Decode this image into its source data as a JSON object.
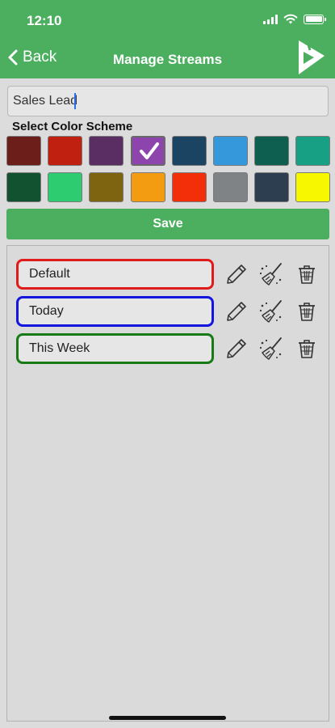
{
  "status_bar": {
    "time": "12:10"
  },
  "nav": {
    "back_label": "Back",
    "title": "Manage Streams"
  },
  "stream_form": {
    "name_value": "Sales Lead",
    "color_label": "Select Color Scheme",
    "swatches": [
      "#6b1e1a",
      "#c0200f",
      "#5a2d63",
      "#8e44ad",
      "#1a4462",
      "#3498db",
      "#0e5f4f",
      "#18a085",
      "#135230",
      "#2ecc71",
      "#7e6410",
      "#f39c12",
      "#f22f08",
      "#7f8385",
      "#2c3e50",
      "#f7f700"
    ],
    "selected_index": 3,
    "save_label": "Save"
  },
  "streams": [
    {
      "name": "Default",
      "color": "#e01b1b"
    },
    {
      "name": "Today",
      "color": "#1515e0"
    },
    {
      "name": "This Week",
      "color": "#177a17"
    }
  ],
  "colors": {
    "brand": "#4caf60"
  },
  "icons": [
    "signal-icon",
    "wifi-icon",
    "battery-icon",
    "chevron-left-icon",
    "app-logo-icon",
    "check-icon",
    "pencil-icon",
    "brush-icon",
    "trash-icon"
  ]
}
